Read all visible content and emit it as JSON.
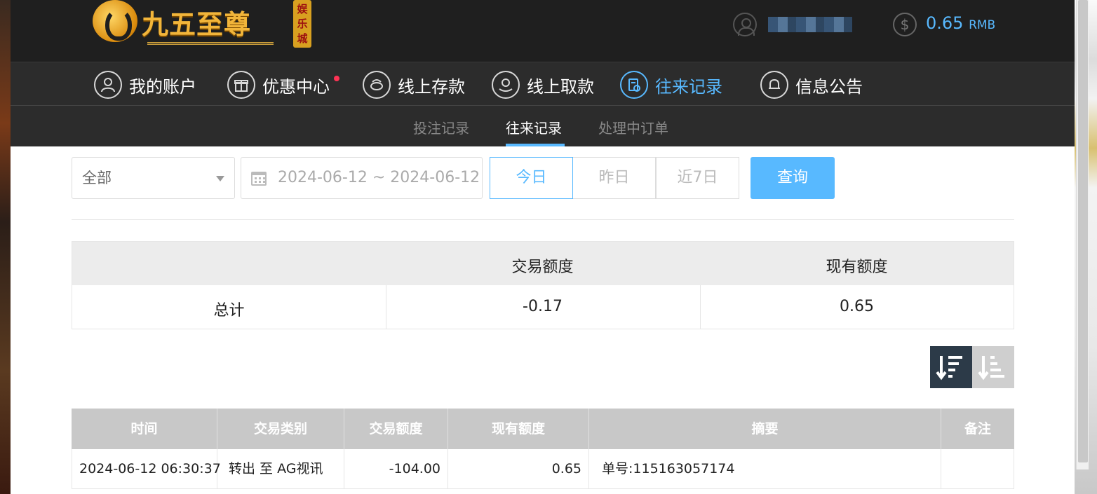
{
  "header": {
    "logo_text": "九五至尊",
    "logo_badge": "娱乐城",
    "balance_amount": "0.65",
    "balance_unit": "RMB"
  },
  "nav": {
    "items": [
      {
        "label": "我的账户",
        "icon": "user-icon"
      },
      {
        "label": "优惠中心",
        "icon": "gift-icon"
      },
      {
        "label": "线上存款",
        "icon": "deposit-icon"
      },
      {
        "label": "线上取款",
        "icon": "withdraw-icon"
      },
      {
        "label": "往来记录",
        "icon": "records-icon",
        "active": true
      },
      {
        "label": "信息公告",
        "icon": "bell-icon"
      }
    ]
  },
  "subnav": {
    "items": [
      {
        "label": "投注记录"
      },
      {
        "label": "往来记录",
        "active": true
      },
      {
        "label": "处理中订单"
      }
    ]
  },
  "filters": {
    "type_select": "全部",
    "date_range": "2024-06-12 ~ 2024-06-12",
    "quick": [
      "今日",
      "昨日",
      "近7日"
    ],
    "query_label": "查询"
  },
  "summary": {
    "headers": [
      "",
      "交易额度",
      "现有额度"
    ],
    "row": {
      "label": "总计",
      "amount": "-0.17",
      "balance": "0.65"
    }
  },
  "records": {
    "headers": [
      "时间",
      "交易类别",
      "交易额度",
      "现有额度",
      "摘要",
      "备注"
    ],
    "rows": [
      {
        "time": "2024-06-12 06:30:37",
        "type": "转出 至 AG视讯",
        "amount": "-104.00",
        "balance": "0.65",
        "summary": "单号:115163057174",
        "note": ""
      }
    ]
  },
  "colors": {
    "accent": "#58b9ff",
    "header_bg": "#1f1f1f",
    "nav_bg": "#2c2c2c",
    "notice_dot": "#ff3355"
  }
}
